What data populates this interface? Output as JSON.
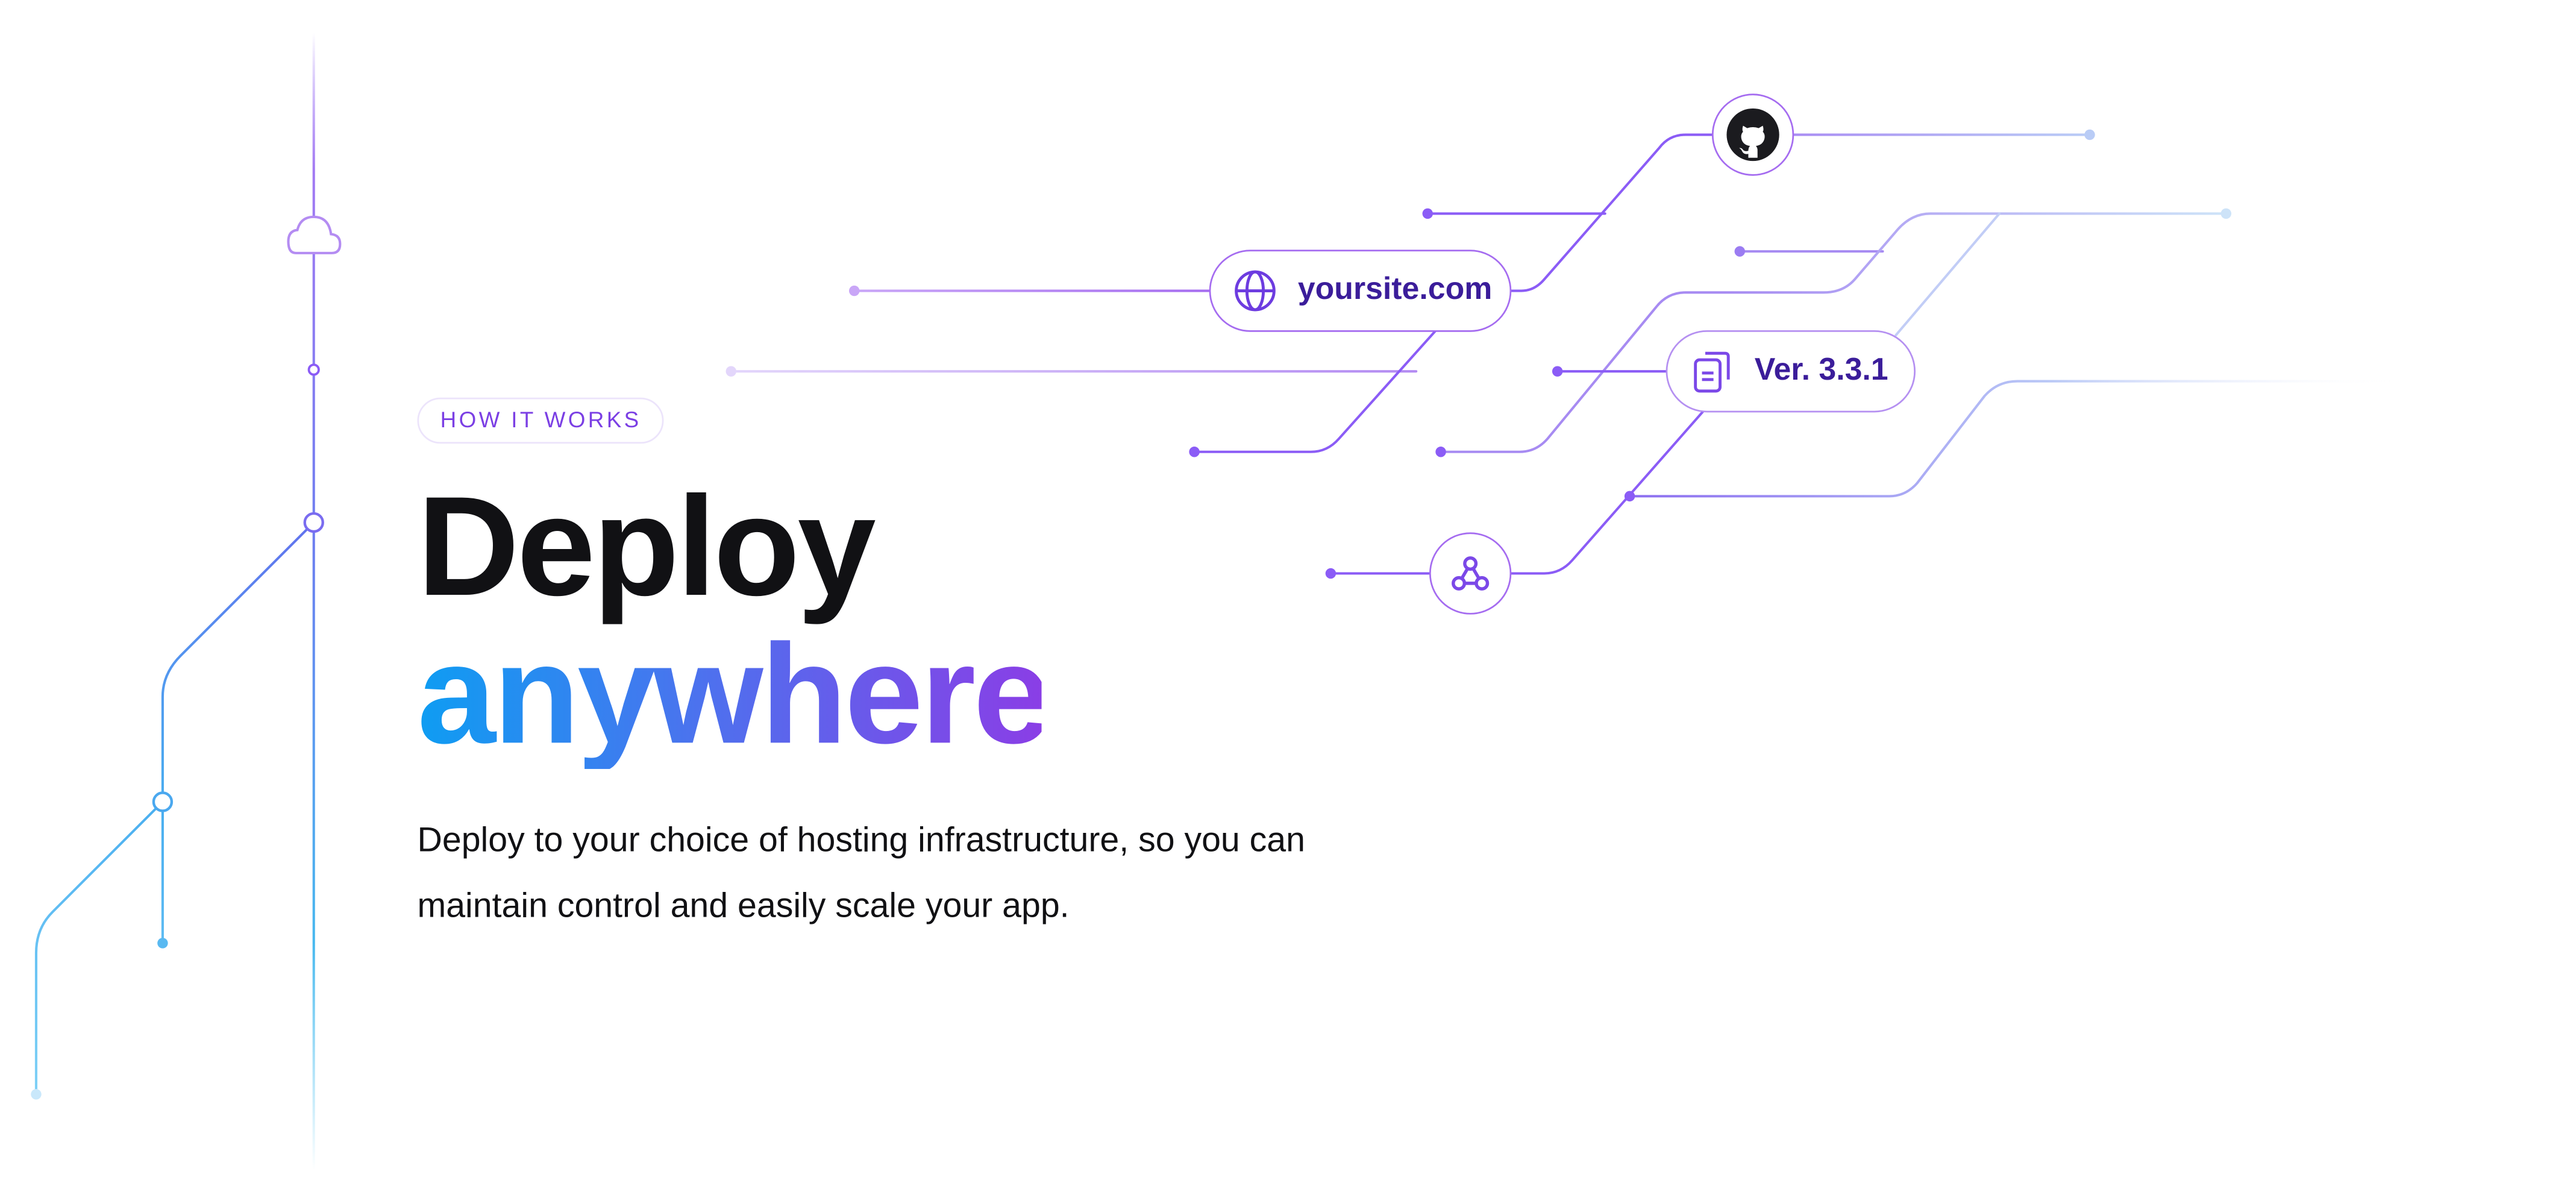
{
  "section": {
    "badge": "HOW IT WORKS",
    "headline_line_1": "Deploy",
    "headline_line_2": "anywhere",
    "description": "Deploy to your choice of hosting infrastructure, so you can maintain control and easily scale your app."
  },
  "diagram": {
    "domain_pill": {
      "label": "yoursite.com",
      "icon": "globe-icon"
    },
    "version_pill": {
      "label": "Ver. 3.3.1",
      "icon": "documents-icon"
    },
    "github_node": {
      "icon": "github-icon"
    },
    "webhook_node": {
      "icon": "webhook-icon"
    },
    "pipeline_icon": "cloud-icon"
  },
  "colors": {
    "violet": "#8b5cf6",
    "blue": "#0ea5e9",
    "ink": "#111114",
    "badge_text": "#7b3fe4"
  }
}
